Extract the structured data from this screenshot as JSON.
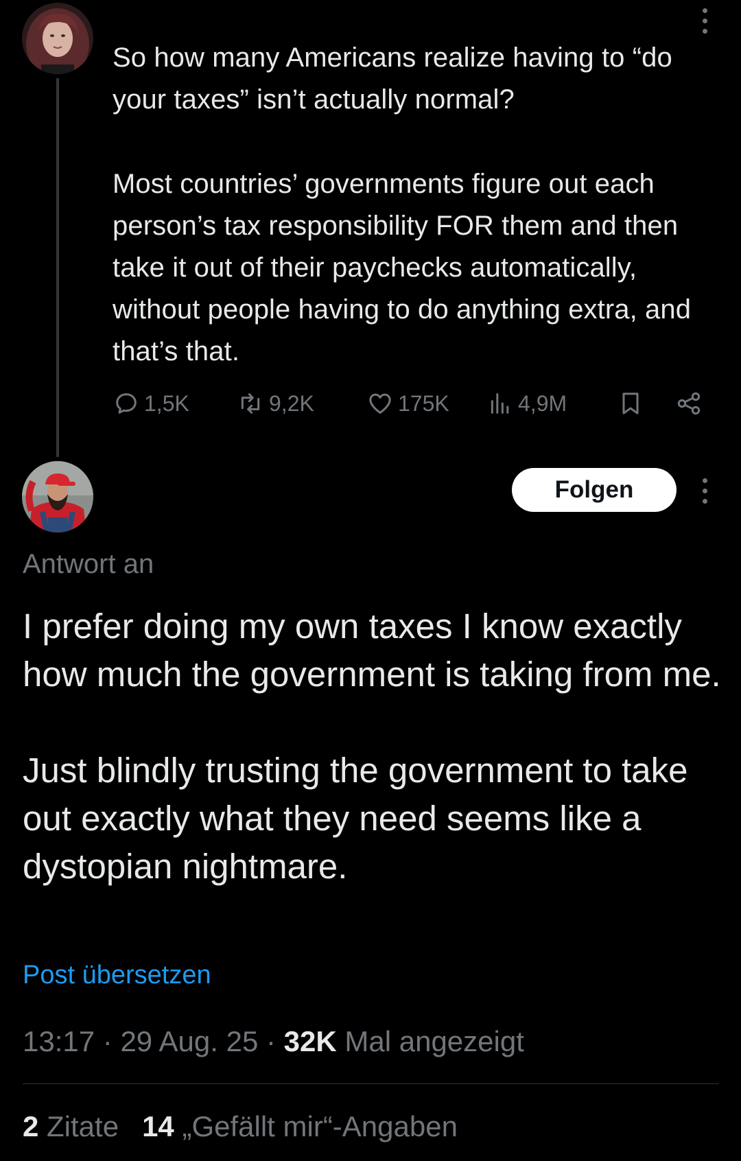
{
  "colors": {
    "background": "#000000",
    "text_primary": "#e7e9ea",
    "text_secondary": "#71767b",
    "link": "#1d9bf0",
    "follow_button_bg": "#ffffff",
    "follow_button_text": "#0f1419"
  },
  "parent_tweet": {
    "avatar_icon": "user-avatar-woman",
    "more_icon": "more-vertical-icon",
    "text": [
      "So how many Americans realize having to “do your taxes” isn’t actually normal?",
      "Most countries’ governments figure out each person’s tax responsibility FOR them and then take it out of their paychecks automatically, without people having to do anything extra, and that’s that."
    ],
    "actions": {
      "replies": "1,5K",
      "reposts": "9,2K",
      "likes": "175K",
      "views": "4,9M"
    }
  },
  "reply_tweet": {
    "avatar_icon": "user-avatar-man-red-cap",
    "follow_label": "Folgen",
    "more_icon": "more-vertical-icon",
    "reply_to_label": "Antwort an",
    "text": [
      "I prefer doing my own taxes I know exactly how much the government is taking from me.",
      "Just blindly trusting the government to take out exactly what they need seems like a dystopian nightmare."
    ],
    "translate_label": "Post übersetzen",
    "time": "13:17",
    "date": "29 Aug. 25",
    "separator": "·",
    "views_count": "32K",
    "views_label": "Mal angezeigt",
    "quotes_count": "2",
    "quotes_label": "Zitate",
    "likes_count": "14",
    "likes_label": "„Gefällt mir“-Angaben"
  }
}
